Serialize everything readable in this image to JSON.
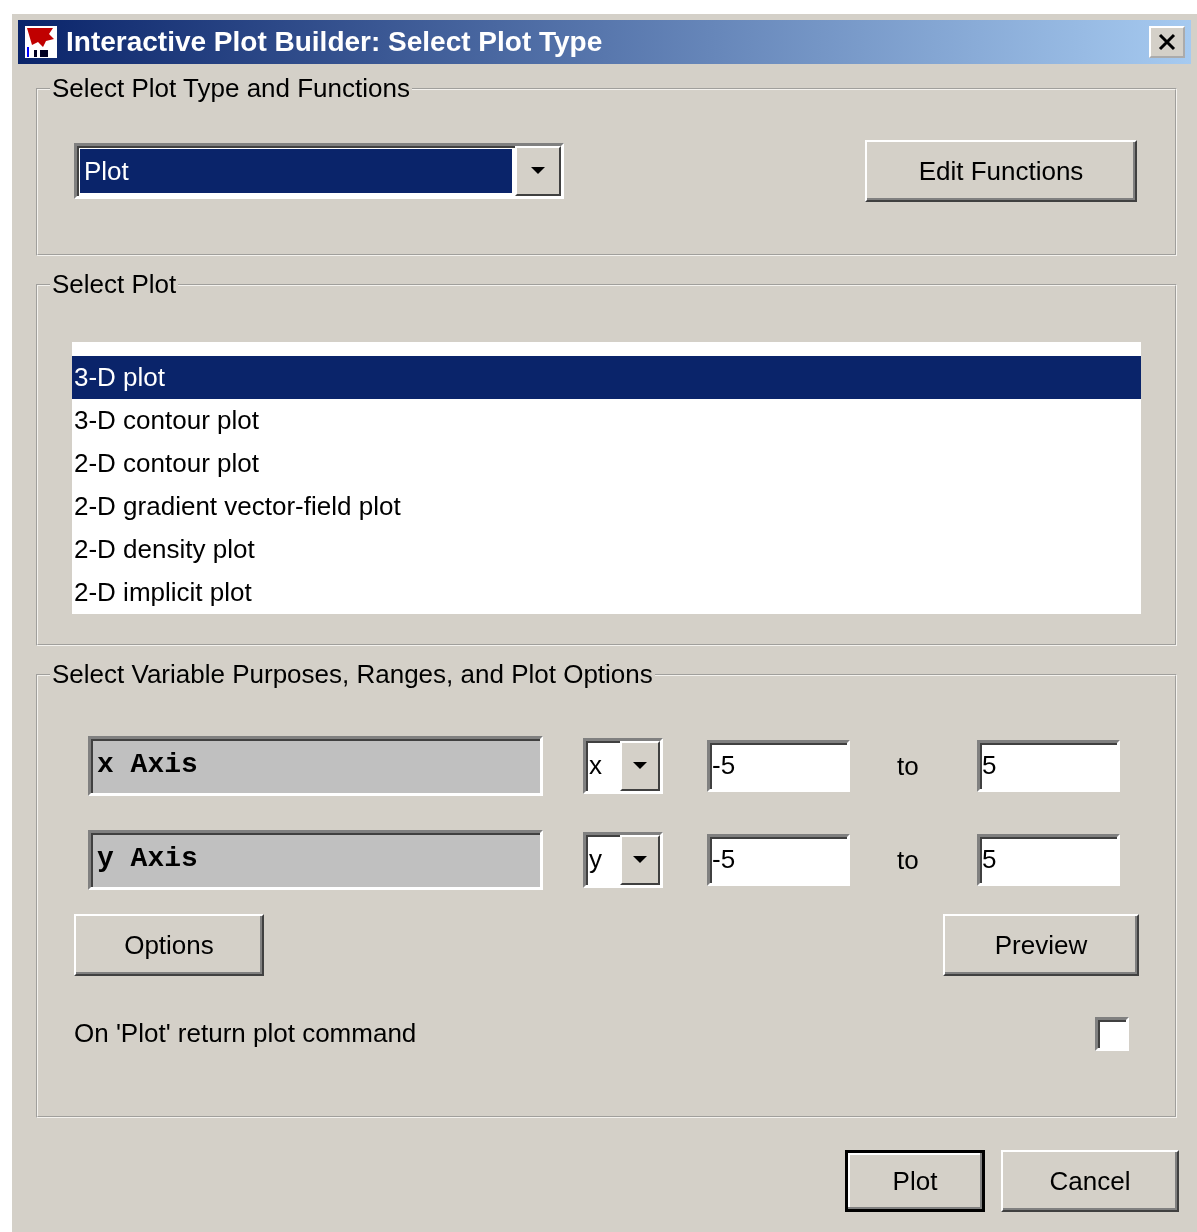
{
  "window": {
    "title": "Interactive Plot Builder: Select Plot Type"
  },
  "plot_type_group": {
    "legend": "Select Plot Type and Functions",
    "plot_type": {
      "value": "Plot"
    },
    "edit_button": "Edit Functions"
  },
  "plot_group": {
    "legend": "Select Plot",
    "plots": [
      {
        "label": "3-D plot",
        "selected": true
      },
      {
        "label": "3-D contour plot",
        "selected": false
      },
      {
        "label": "2-D contour plot",
        "selected": false
      },
      {
        "label": "2-D gradient vector-field plot",
        "selected": false
      },
      {
        "label": "2-D density plot",
        "selected": false
      },
      {
        "label": "2-D implicit plot",
        "selected": false
      }
    ]
  },
  "variables_group": {
    "legend": "Select Variable Purposes, Ranges, and Plot Options",
    "variables": [
      {
        "name": "x Axis",
        "variable": "x",
        "from": "-5",
        "to_label": "to",
        "to": "5"
      },
      {
        "name": "y Axis",
        "variable": "y",
        "from": "-5",
        "to_label": "to",
        "to": "5"
      }
    ],
    "options_button": "Options",
    "preview_button": "Preview",
    "return_command": {
      "label": "On 'Plot' return plot command",
      "checked": false
    }
  },
  "buttons": [
    {
      "label": "Plot",
      "default": true
    },
    {
      "label": "Cancel",
      "default": false
    }
  ]
}
